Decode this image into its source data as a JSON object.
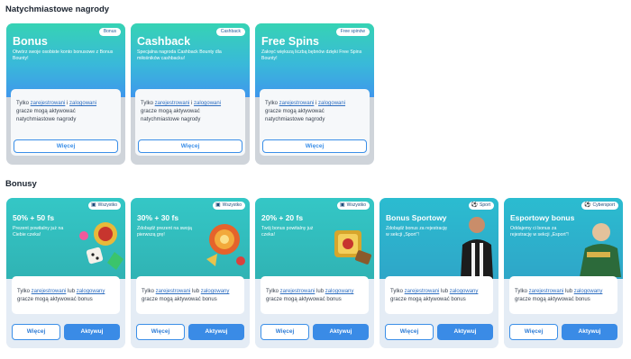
{
  "instant": {
    "title": "Natychmiastowe nagrody",
    "cards": [
      {
        "title": "Bonus",
        "tag": "Bonus",
        "desc": "Otwórz swoje osobiste konto bonusowe z Bonus Bounty!",
        "p1": "Tylko ",
        "l1": "zarejestrowani",
        "p2": " i ",
        "l2": "zalogowani",
        "p3": " gracze mogą aktywować natychmiastowe nagrody",
        "more": "Więcej"
      },
      {
        "title": "Cashback",
        "tag": "Cashback",
        "desc": "Specjalna nagroda Cashback Bounty dla miłośników cashbacku!",
        "p1": "Tylko ",
        "l1": "zarejestrowani",
        "p2": " i ",
        "l2": "zalogowani",
        "p3": " gracze mogą aktywować natychmiastowe nagrody",
        "more": "Więcej"
      },
      {
        "title": "Free Spins",
        "tag": "Free spinów",
        "desc": "Zakręć większą liczbą bębnów dzięki Free Spins Bounty!",
        "p1": "Tylko ",
        "l1": "zarejestrowani",
        "p2": " i ",
        "l2": "zalogowani",
        "p3": " gracze mogą aktywować natychmiastowe nagrody",
        "more": "Więcej"
      }
    ]
  },
  "bonuses": {
    "title": "Bonusy",
    "cards": [
      {
        "title": "50% + 50 fs",
        "tag": "Wszystko",
        "tag_icon": "casino-icon",
        "desc": "Prezent powitalny już na Ciebie czeka!",
        "p1": "Tylko ",
        "l1": "zarejestrowani",
        "p2": " lub ",
        "l2": "zalogowany",
        "p3": " gracze mogą aktywować bonus",
        "more": "Więcej",
        "activate": "Aktywuj"
      },
      {
        "title": "30% + 30 fs",
        "tag": "Wszystko",
        "tag_icon": "casino-icon",
        "desc": "Zdobądź prezent na swoją pierwszą grę!",
        "p1": "Tylko ",
        "l1": "zarejestrowani",
        "p2": " lub ",
        "l2": "zalogowany",
        "p3": " gracze mogą aktywować bonus",
        "more": "Więcej",
        "activate": "Aktywuj"
      },
      {
        "title": "20% + 20 fs",
        "tag": "Wszystko",
        "tag_icon": "casino-icon",
        "desc": "Twój bonus powitalny już czeka!",
        "p1": "Tylko ",
        "l1": "zarejestrowani",
        "p2": " lub ",
        "l2": "zalogowany",
        "p3": " gracze mogą aktywować bonus",
        "more": "Więcej",
        "activate": "Aktywuj"
      },
      {
        "title": "Bonus Sportowy",
        "tag": "Sport",
        "tag_icon": "soccer-ball-icon",
        "desc": "Zdobądź bonus za rejestrację w sekcji „Sport”!",
        "p1": "Tylko ",
        "l1": "zarejestrowani",
        "p2": " lub ",
        "l2": "zalogowany",
        "p3": " gracze mogą aktywować bonus",
        "more": "Więcej",
        "activate": "Aktywuj"
      },
      {
        "title": "Esportowy bonus",
        "tag": "Cybersport",
        "tag_icon": "soccer-ball-icon",
        "desc": "Oddajemy ci bonus za rejestrację w sekcji „Esport”!",
        "p1": "Tylko ",
        "l1": "zarejestrowani",
        "p2": " lub ",
        "l2": "zalogowany",
        "p3": " gracze mogą aktywować bonus",
        "more": "Więcej",
        "activate": "Aktywuj"
      }
    ]
  },
  "colors": {
    "accent": "#3a8be6",
    "card_teal": "#34c7c6",
    "link": "#2f6fc1"
  }
}
